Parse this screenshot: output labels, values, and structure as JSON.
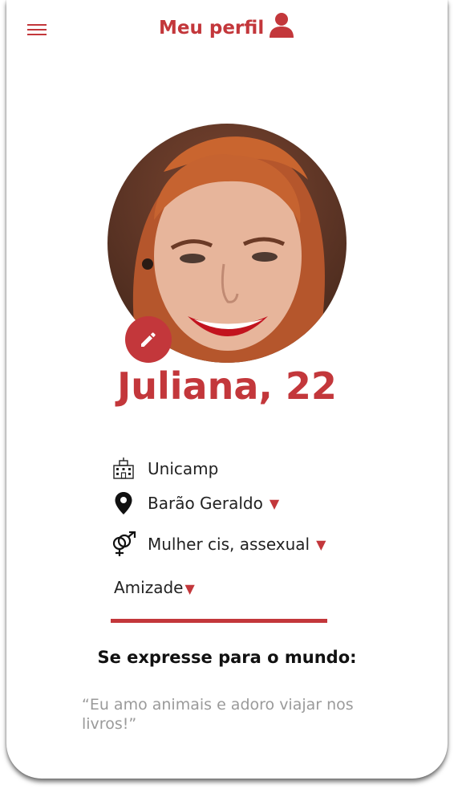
{
  "header": {
    "title": "Meu perfil",
    "menu_icon": "hamburger-menu-icon",
    "profile_icon": "user-icon"
  },
  "profile": {
    "name_age": "Juliana, 22",
    "photo": "profile-photo",
    "edit_icon": "pencil-icon",
    "accent_color": "#c3373b"
  },
  "details": {
    "university": {
      "icon": "school-building-icon",
      "value": "Unicamp"
    },
    "location": {
      "icon": "map-pin-icon",
      "value": "Barão Geraldo",
      "dropdown": "▼"
    },
    "identity": {
      "icon": "gender-symbol-icon",
      "value": "Mulher cis, assexual",
      "dropdown": "▼"
    },
    "goal": {
      "value": "Amizade",
      "dropdown": "▼"
    }
  },
  "bio": {
    "title": "Se expresse para o mundo:",
    "text": "“Eu amo animais e adoro viajar nos livros!”"
  }
}
